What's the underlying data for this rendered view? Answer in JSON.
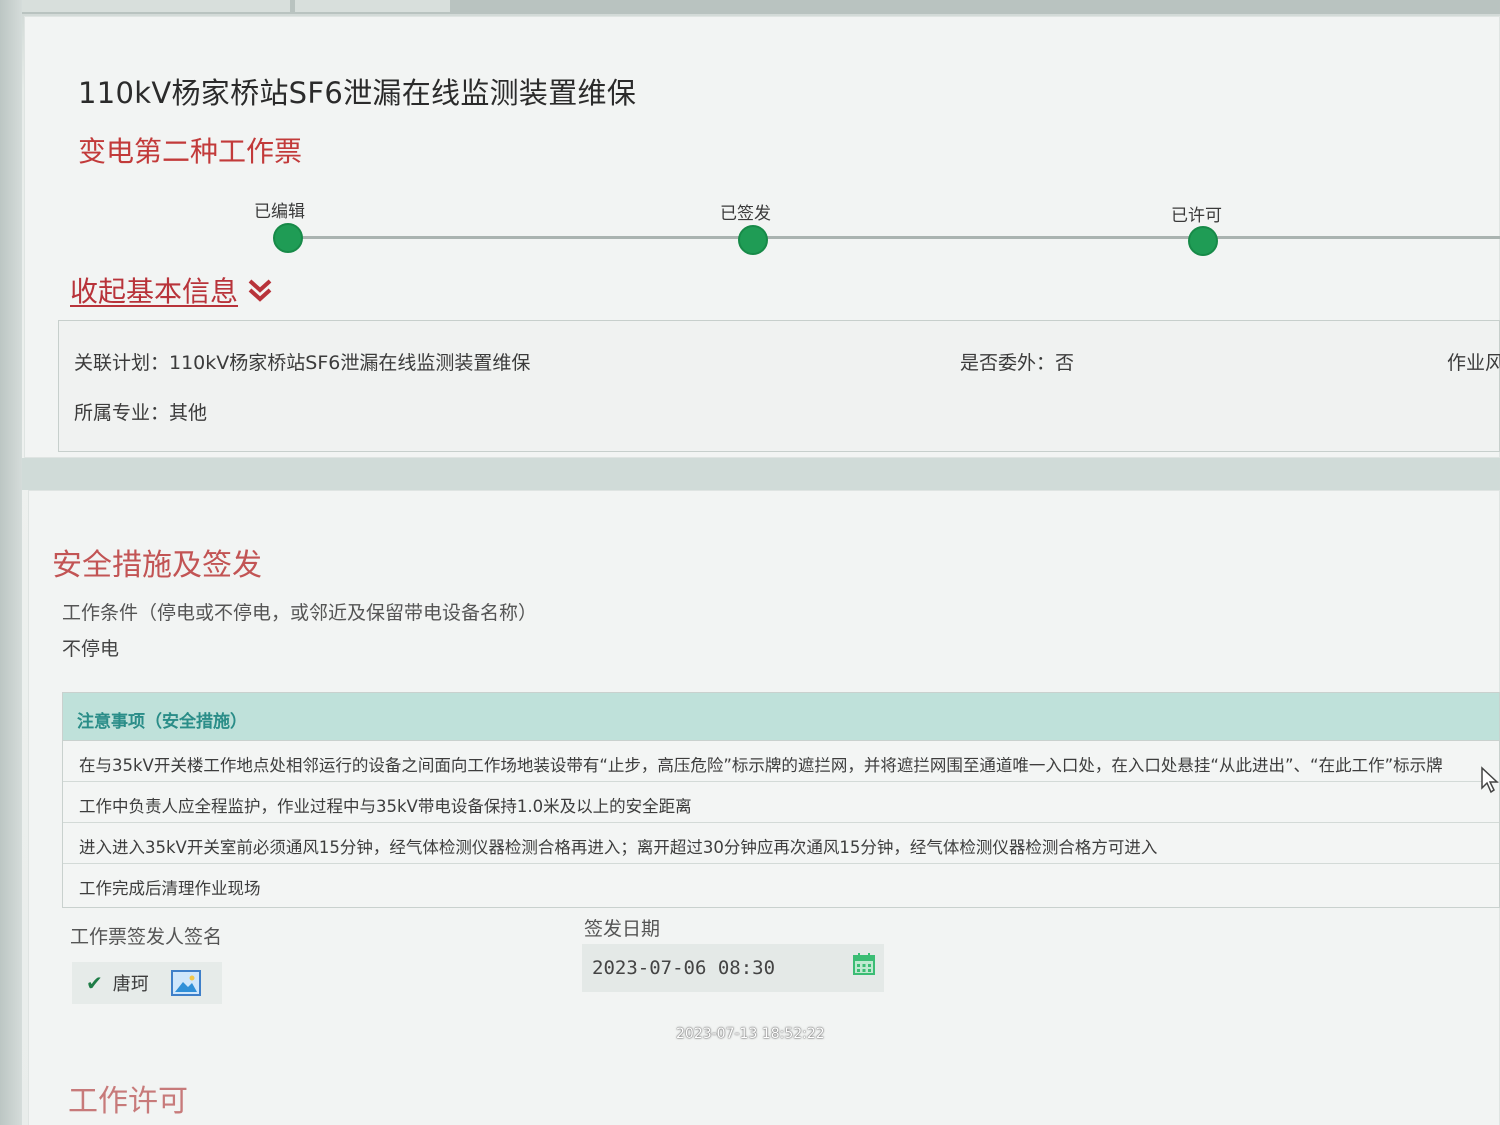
{
  "header": {
    "ticket_title": "110kV杨家桥站SF6泄漏在线监测装置维保",
    "ticket_type": "变电第二种工作票"
  },
  "progress": {
    "steps": [
      {
        "label": "已编辑",
        "state": "done"
      },
      {
        "label": "已签发",
        "state": "done"
      },
      {
        "label": "已许可",
        "state": "done"
      }
    ],
    "done_color": "#1f9c55"
  },
  "basic_info": {
    "toggle_label": "收起基本信息",
    "related_plan": "关联计划：110kV杨家桥站SF6泄漏在线监测装置维保",
    "outsourced": "是否委外：否",
    "work_partial": "作业风",
    "specialty": "所属专业：其他"
  },
  "safety": {
    "section_title": "安全措施及签发",
    "work_condition_label": "工作条件（停电或不停电，或邻近及保留带电设备名称）",
    "work_condition_value": "不停电",
    "notice_header": "注意事项（安全措施）",
    "notices": [
      "在与35kV开关楼工作地点处相邻运行的设备之间面向工作场地装设带有“止步，高压危险”标示牌的遮拦网，并将遮拦网围至通道唯一入口处，在入口处悬挂“从此进出”、“在此工作”标示牌",
      "工作中负责人应全程监护，作业过程中与35kV带电设备保持1.0米及以上的安全距离",
      "进入进入35kV开关室前必须通风15分钟，经气体检测仪器检测合格再进入；离开超过30分钟应再次通风15分钟，经气体检测仪器检测合格方可进入",
      "工作完成后清理作业现场"
    ],
    "signer_label": "工作票签发人签名",
    "signer_name": "唐珂",
    "issue_date_label": "签发日期",
    "issue_date_value": "2023-07-06 08:30"
  },
  "permit": {
    "section_title": "工作许可"
  },
  "photo_timestamp": "2023-07-13 18:52:22",
  "icons": {
    "collapse": "double-chevron-down-icon",
    "check": "check-icon",
    "image": "image-icon",
    "calendar": "calendar-icon",
    "cursor": "mouse-cursor-icon"
  }
}
